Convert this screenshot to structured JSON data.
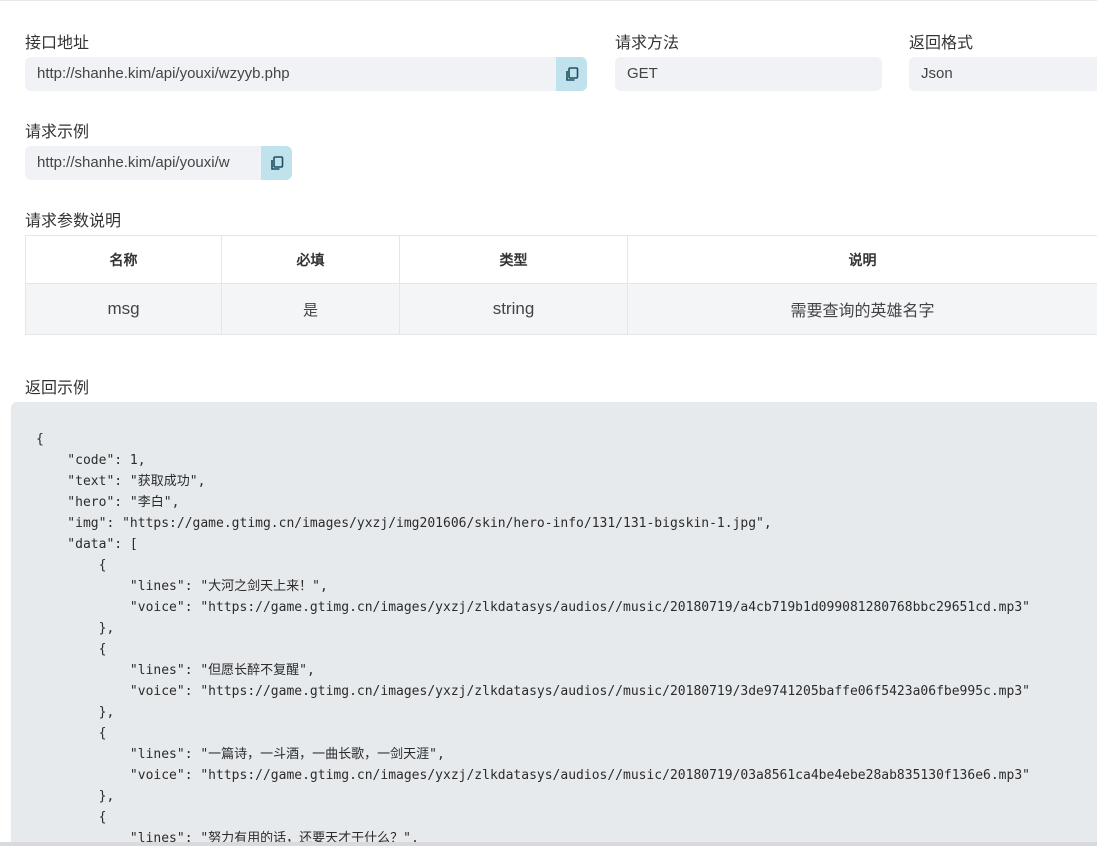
{
  "api_url": {
    "label": "接口地址",
    "value": "http://shanhe.kim/api/youxi/wzyyb.php",
    "copy_icon": "copy-icon"
  },
  "method": {
    "label": "请求方法",
    "value": "GET"
  },
  "format": {
    "label": "返回格式",
    "value": "Json"
  },
  "example": {
    "label": "请求示例",
    "value": "http://shanhe.kim/api/youxi/w",
    "copy_icon": "copy-icon"
  },
  "params": {
    "label": "请求参数说明",
    "headers": [
      "名称",
      "必填",
      "类型",
      "说明"
    ],
    "rows": [
      [
        "msg",
        "是",
        "string",
        "需要查询的英雄名字"
      ]
    ]
  },
  "response": {
    "label": "返回示例",
    "code": "{\n    \"code\": 1,\n    \"text\": \"获取成功\",\n    \"hero\": \"李白\",\n    \"img\": \"https://game.gtimg.cn/images/yxzj/img201606/skin/hero-info/131/131-bigskin-1.jpg\",\n    \"data\": [\n        {\n            \"lines\": \"大河之剑天上来！\",\n            \"voice\": \"https://game.gtimg.cn/images/yxzj/zlkdatasys/audios//music/20180719/a4cb719b1d099081280768bbc29651cd.mp3\"\n        },\n        {\n            \"lines\": \"但愿长醉不复醒\",\n            \"voice\": \"https://game.gtimg.cn/images/yxzj/zlkdatasys/audios//music/20180719/3de9741205baffe06f5423a06fbe995c.mp3\"\n        },\n        {\n            \"lines\": \"一篇诗，一斗酒，一曲长歌，一剑天涯\",\n            \"voice\": \"https://game.gtimg.cn/images/yxzj/zlkdatasys/audios//music/20180719/03a8561ca4be4ebe28ab835130f136e6.mp3\"\n        },\n        {\n            \"lines\": \"努力有用的话，还要天才干什么？\","
  }
}
